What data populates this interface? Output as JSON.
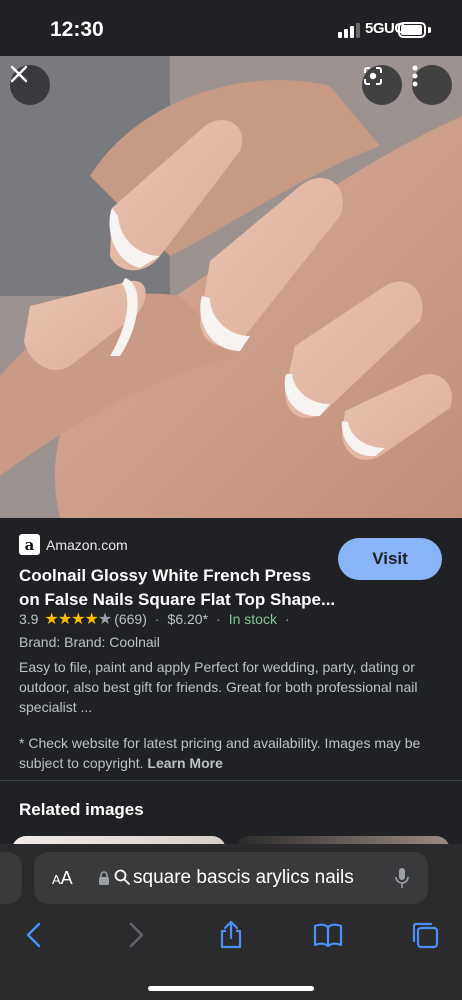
{
  "status_bar": {
    "time": "12:30",
    "network": "5GUC",
    "battery_icon": "battery-icon"
  },
  "photo_viewer": {
    "close_icon": "close-icon",
    "lens_icon": "lens-icon",
    "more_icon": "more-vertical-icon"
  },
  "result": {
    "source": "Amazon.com",
    "source_logo_letter": "a",
    "visit_label": "Visit",
    "title_line1": "Coolnail Glossy White French Press",
    "title_line2": "on False Nails Square Flat Top Shape...",
    "rating": "3.9",
    "stars_filled": "★★★★",
    "stars_empty": "★",
    "reviews": "(669)",
    "price": "$6.20*",
    "availability": "In stock",
    "sep": "·",
    "brand": "Brand: Brand: Coolnail",
    "description": "Easy to file, paint and apply Perfect for wedding, party, dating or outdoor, also best gift for friends. Great for both professional nail specialist ...",
    "notice": "* Check website for latest pricing and availability. Images may be subject to copyright.",
    "learn_more": "Learn More"
  },
  "related": {
    "title": "Related images"
  },
  "safari": {
    "aa_large": "A",
    "aa_small": "A",
    "url_text": "square bascis arylics nails",
    "icons": [
      "back-icon",
      "forward-icon",
      "share-icon",
      "bookmarks-icon",
      "tabs-icon"
    ]
  },
  "colors": {
    "accent": "#8ab4f8",
    "star": "#fbbc04",
    "in_stock": "#81c995",
    "background": "#202124"
  }
}
